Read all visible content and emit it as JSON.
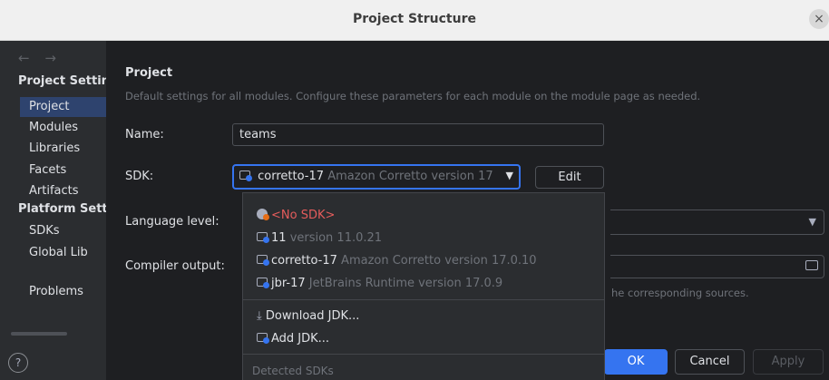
{
  "window": {
    "title": "Project Structure",
    "close_glyph": "×"
  },
  "sidebar": {
    "nav_arrows": "← →",
    "project_settings_heading": "Project Setting",
    "project_items": [
      "Project",
      "Modules",
      "Libraries",
      "Facets",
      "Artifacts"
    ],
    "platform_settings_heading": "Platform Settir",
    "platform_items": [
      "SDKs",
      "Global Lib"
    ],
    "problems_label": "Problems",
    "selected_item": "Project",
    "selection_color": "#2e436e"
  },
  "content": {
    "title": "Project",
    "description": "Default settings for all modules. Configure these parameters for each module on the module page as needed.",
    "name_label": "Name:",
    "name_value": "teams",
    "sdk_label": "SDK:",
    "sdk_selected_name": "corretto-17",
    "sdk_selected_detail": "Amazon Corretto version 17",
    "edit_label": "Edit",
    "language_level_label": "Language level:",
    "compiler_output_label": "Compiler output:",
    "hint_text": "he corresponding sources.",
    "accent_color": "#3574f0"
  },
  "sdk_popup": {
    "items": [
      {
        "icon": "no-sdk-icon",
        "name": "<No SDK>",
        "detail": ""
      },
      {
        "icon": "jdk-folder-icon",
        "name": "11",
        "detail": "version 11.0.21"
      },
      {
        "icon": "jdk-folder-icon",
        "name": "corretto-17",
        "detail": "Amazon Corretto version 17.0.10"
      },
      {
        "icon": "jdk-folder-icon",
        "name": "jbr-17",
        "detail": "JetBrains Runtime version 17.0.9"
      }
    ],
    "download_label": "Download JDK...",
    "add_label": "Add JDK...",
    "detected_heading": "Detected SDKs"
  },
  "footer": {
    "help_glyph": "?",
    "ok_label": "OK",
    "cancel_label": "Cancel",
    "apply_label": "Apply"
  }
}
